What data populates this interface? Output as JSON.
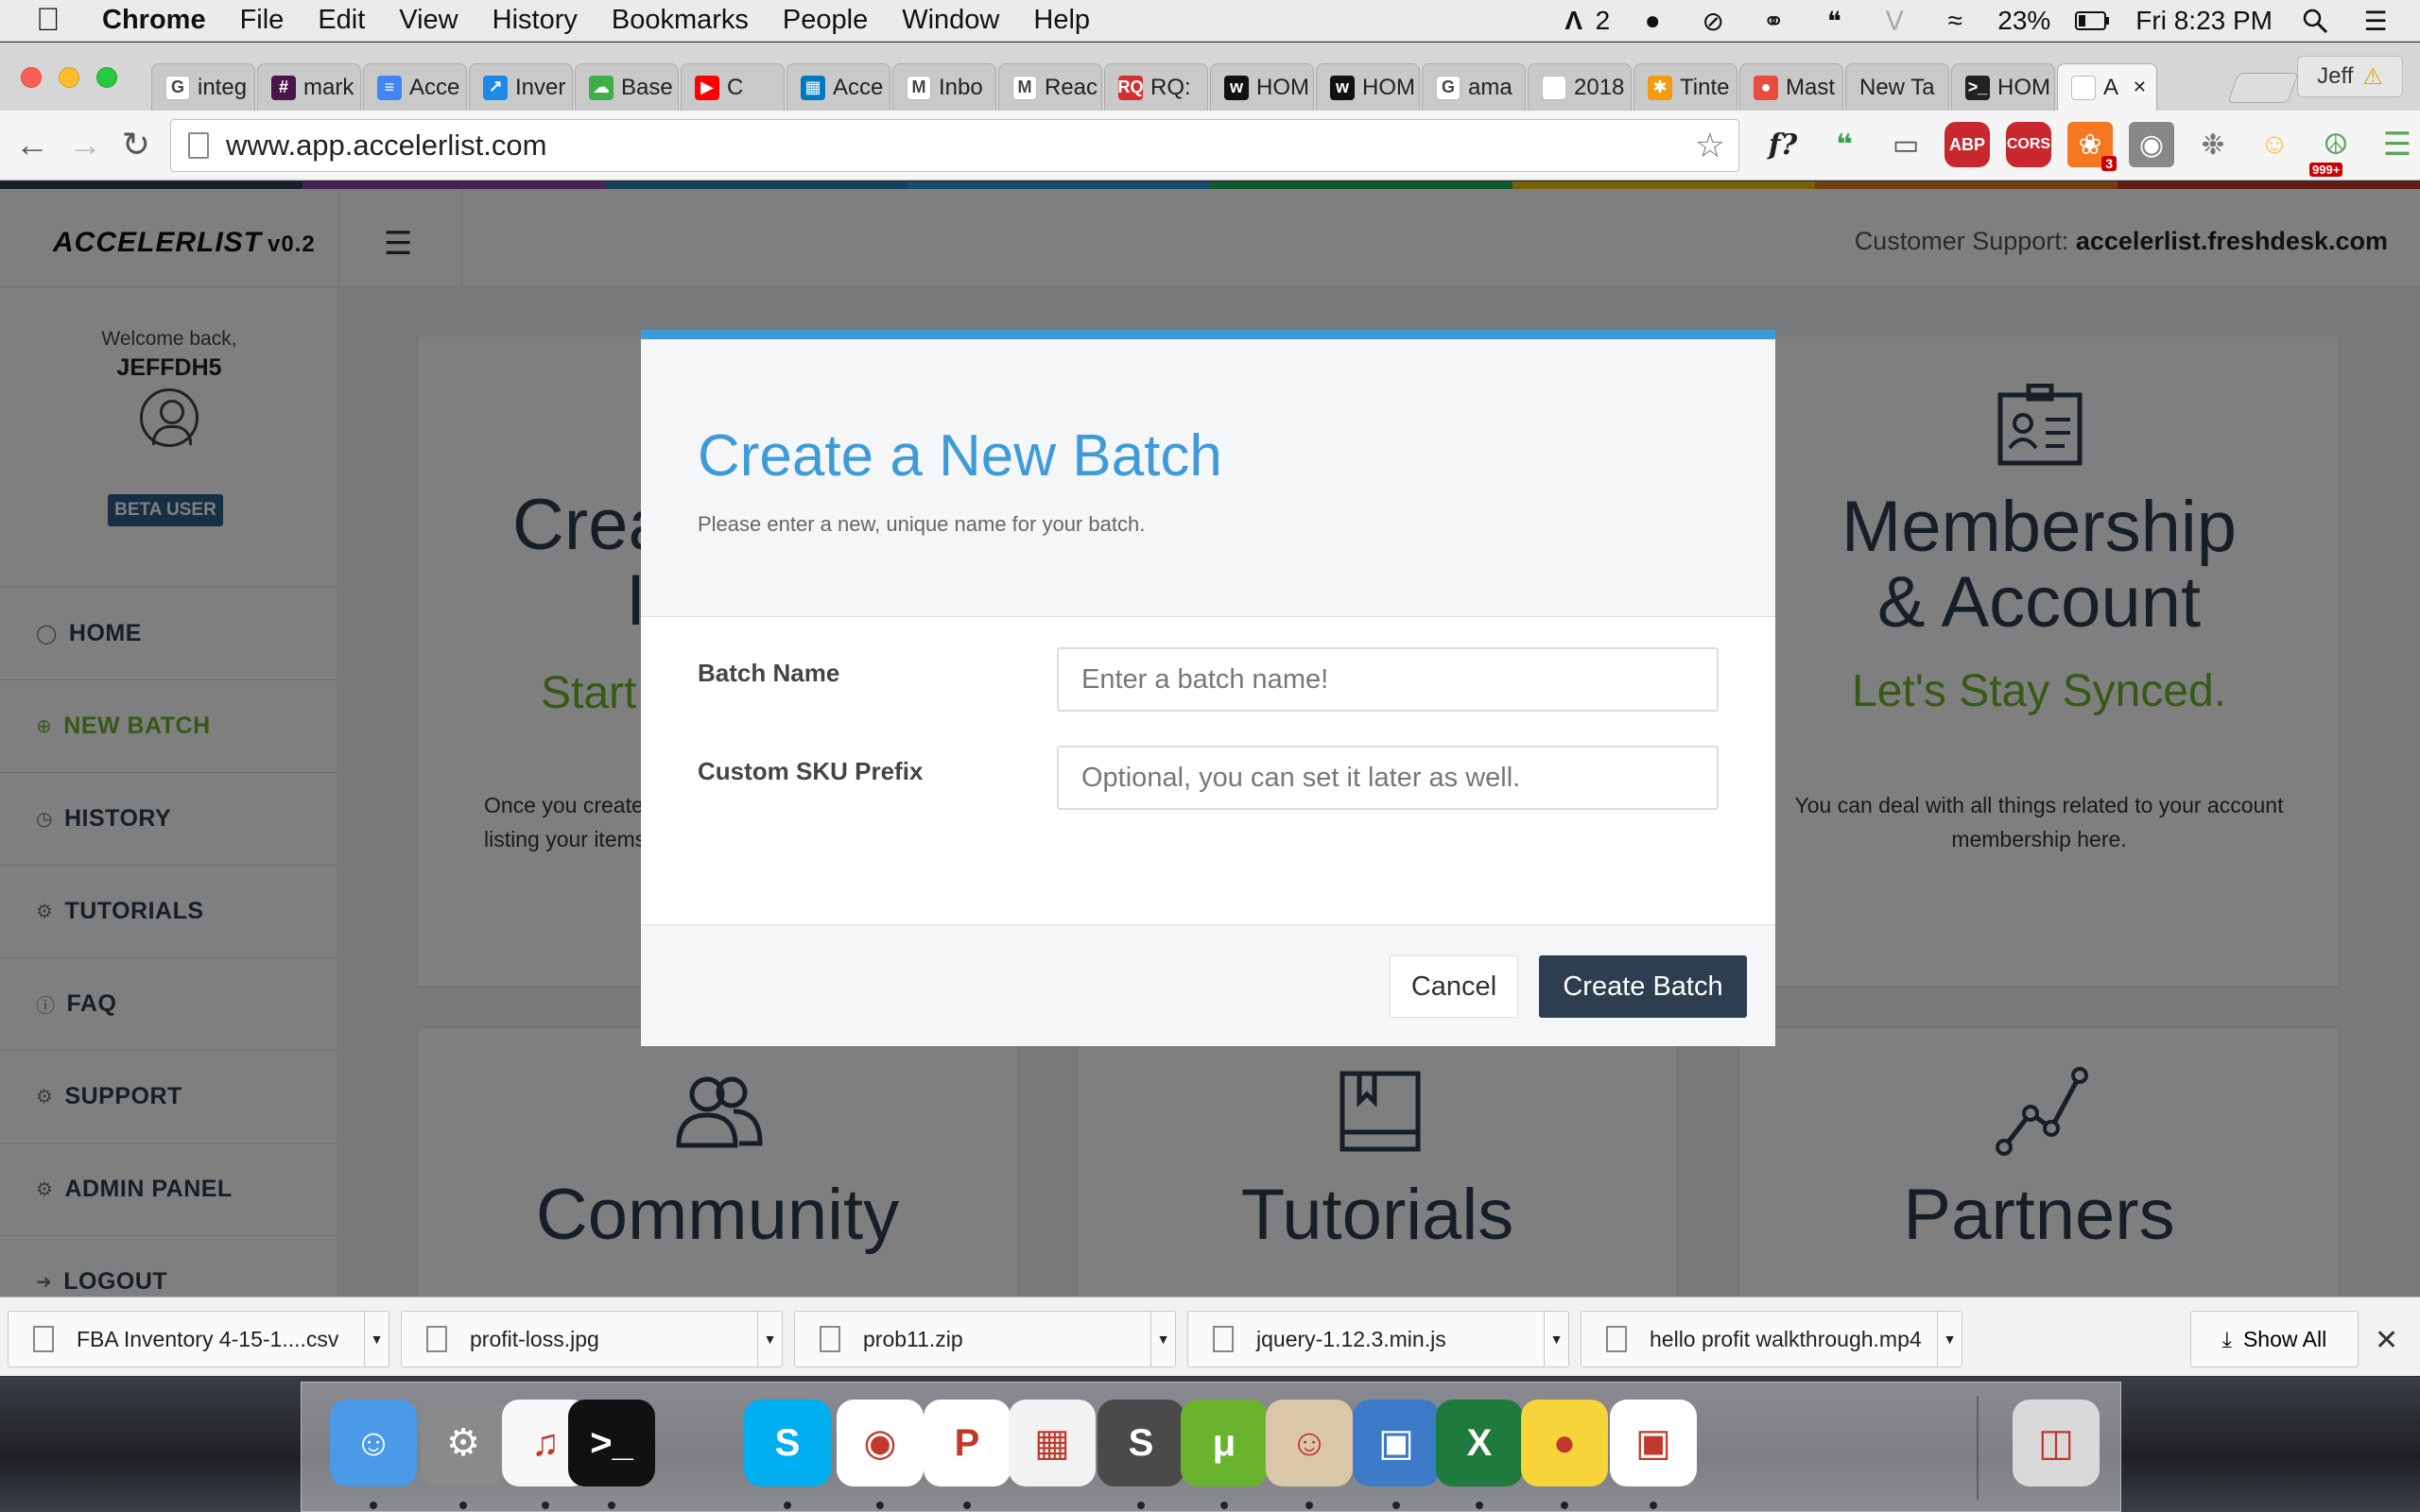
{
  "menubar": {
    "app_name": "Chrome",
    "menus": [
      "File",
      "Edit",
      "View",
      "History",
      "Bookmarks",
      "People",
      "Window",
      "Help"
    ],
    "adobe_count": "2",
    "battery": "23%",
    "clock": "Fri 8:23 PM"
  },
  "tabs": [
    {
      "label": "integ",
      "icon": "google-icon",
      "color": "#ffffff"
    },
    {
      "label": "mark",
      "icon": "slack-icon",
      "color": "#4a154b"
    },
    {
      "label": "Acce",
      "icon": "docs-icon",
      "color": "#4285f4"
    },
    {
      "label": "Inver",
      "icon": "chart-icon",
      "color": "#1e88e5"
    },
    {
      "label": "Base",
      "icon": "cloud-icon",
      "color": "#3fae49"
    },
    {
      "label": "C",
      "icon": "youtube-icon",
      "color": "#ff0000"
    },
    {
      "label": "Acce",
      "icon": "trello-icon",
      "color": "#0079bf"
    },
    {
      "label": "Inbo",
      "icon": "gmail-icon",
      "color": "#ffffff"
    },
    {
      "label": "Reac",
      "icon": "gmail-icon",
      "color": "#ffffff"
    },
    {
      "label": "RQ:",
      "icon": "rq-icon",
      "color": "#d32f2f"
    },
    {
      "label": "HOM",
      "icon": "w-icon",
      "color": "#111111"
    },
    {
      "label": "HOM",
      "icon": "w-icon",
      "color": "#111111"
    },
    {
      "label": "ama",
      "icon": "google-icon",
      "color": "#ffffff"
    },
    {
      "label": "2018",
      "icon": "page-icon",
      "color": "#ffffff"
    },
    {
      "label": "Tinte",
      "icon": "asterisk-icon",
      "color": "#f39c12"
    },
    {
      "label": "Mast",
      "icon": "balloon-icon",
      "color": "#e74c3c"
    },
    {
      "label": "New Ta",
      "icon": "none",
      "color": "#c9c9c9"
    },
    {
      "label": "HOM",
      "icon": "terminal-icon",
      "color": "#222222"
    },
    {
      "label": "A",
      "icon": "page-icon",
      "color": "#ffffff"
    }
  ],
  "profile_name": "Jeff",
  "url": "www.app.accelerlist.com",
  "extensions": [
    "f?",
    "evernote",
    "cast",
    "ABP",
    "CORS",
    "hubspot",
    "ghostery",
    "globe",
    "emoji",
    "peace"
  ],
  "extension_badges": {
    "hubspot": "3",
    "peace": "999+"
  },
  "app": {
    "logo": "ACCELERLIST",
    "version": "v0.2",
    "support_label": "Customer Support:",
    "support_url": "accelerlist.freshdesk.com",
    "brand_colors": [
      "#2d3e50",
      "#8e44ad",
      "#2980b9",
      "#3498db",
      "#27ae60",
      "#f1c40f",
      "#e67e22",
      "#c0392b"
    ]
  },
  "sidebar": {
    "welcome": "Welcome back,",
    "username": "JEFFDH5",
    "badge": "BETA USER",
    "items": [
      {
        "label": "HOME",
        "icon": "home-icon"
      },
      {
        "label": "NEW BATCH",
        "icon": "plus-circle-icon"
      },
      {
        "label": "HISTORY",
        "icon": "clock-icon"
      },
      {
        "label": "TUTORIALS",
        "icon": "lifebuoy-icon"
      },
      {
        "label": "FAQ",
        "icon": "question-icon"
      },
      {
        "label": "SUPPORT",
        "icon": "support-icon"
      },
      {
        "label": "ADMIN PANEL",
        "icon": "admin-icon"
      },
      {
        "label": "LOGOUT",
        "icon": "logout-icon"
      }
    ]
  },
  "cards": {
    "create": {
      "title_line1": "Crea",
      "title_line2": "I",
      "subtitle": "Start",
      "desc_line1": "Once you create a",
      "desc_line2": "listing your items o"
    },
    "membership": {
      "title_line1": "Membership",
      "title_line2": "& Account",
      "subtitle": "Let's Stay Synced.",
      "desc_line1": "You can deal with all things related to your account",
      "desc_line2": "membership here."
    },
    "community": {
      "title": "Community"
    },
    "tutorials": {
      "title": "Tutorials"
    },
    "partners": {
      "title": "Partners"
    }
  },
  "modal": {
    "title": "Create a New Batch",
    "description": "Please enter a new, unique name for your batch.",
    "batch_name_label": "Batch Name",
    "batch_name_placeholder": "Enter a batch name!",
    "sku_label": "Custom SKU Prefix",
    "sku_placeholder": "Optional, you can set it later as well.",
    "cancel": "Cancel",
    "create": "Create Batch"
  },
  "downloads": [
    {
      "name": "FBA Inventory 4-15-1....csv"
    },
    {
      "name": "profit-loss.jpg"
    },
    {
      "name": "prob11.zip"
    },
    {
      "name": "jquery-1.12.3.min.js"
    },
    {
      "name": "hello profit walkthrough.mp4"
    }
  ],
  "show_all": "Show All",
  "dock_apps": [
    "finder",
    "system-preferences",
    "itunes",
    "terminal",
    "skype",
    "chrome",
    "sprout",
    "launchpad",
    "sublime-text",
    "utorrent",
    "contacts",
    "iphoto",
    "excel",
    "cyberduck",
    "screen-recorder",
    "trash"
  ]
}
